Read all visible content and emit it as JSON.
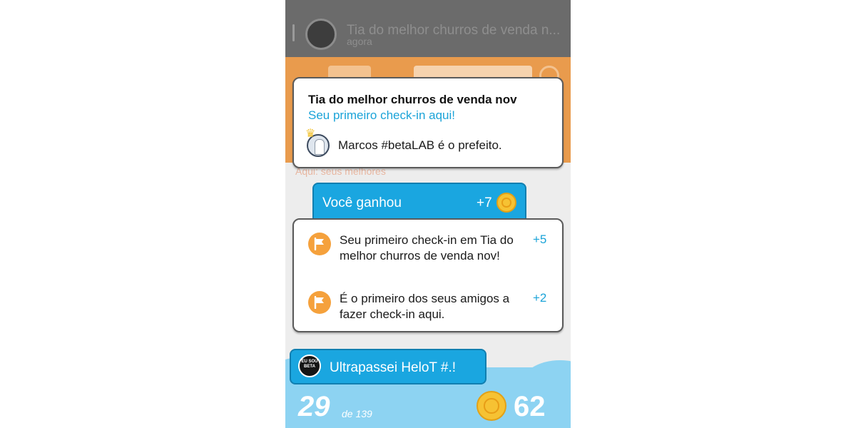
{
  "notification": {
    "title": "Tia do melhor churros de venda n...",
    "time": "agora"
  },
  "background": {
    "venue_hint": "Aqui: seus melhores"
  },
  "mayor_card": {
    "venue_name": "Tia do melhor churros de venda nov",
    "first_checkin": "Seu primeiro check-in aqui!",
    "mayor_text": "Marcos #betaLAB é o prefeito."
  },
  "earned": {
    "label": "Você ganhou",
    "points": "+7"
  },
  "rewards": [
    {
      "text": "Seu primeiro check-in em Tia do melhor churros de venda nov!",
      "points": "+5",
      "icon": "flag-icon"
    },
    {
      "text": "É o primeiro dos seus amigos a fazer check-in aqui.",
      "points": "+2",
      "icon": "flag-icon"
    }
  ],
  "passed": {
    "text": "Ultrapassei HeloT #.!",
    "badge": "EU SOU BETA"
  },
  "leaderboard": {
    "rank": "29",
    "of_total": "de 139",
    "coins": "62"
  },
  "colors": {
    "accent_blue": "#1aa6e0",
    "link_blue": "#1aa3d8",
    "orange": "#f5a13c",
    "coin_yellow": "#f6c233",
    "sky": "#8dd3f2"
  }
}
